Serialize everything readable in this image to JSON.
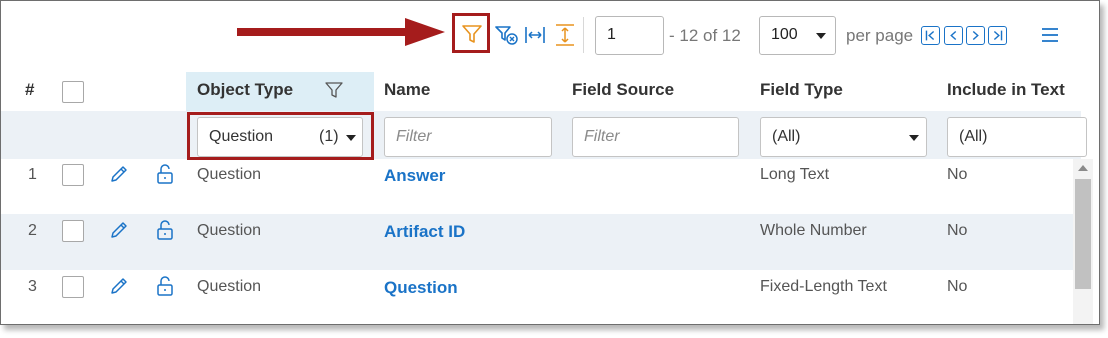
{
  "toolbar": {
    "filter_icon": "filter-icon",
    "clear_filter_icon": "clear-filters-icon",
    "fit_columns_icon": "fit-columns-icon",
    "expand_rows_icon": "expand-rows-icon",
    "menu_icon": "hamburger-menu-icon",
    "accent_color": "#1a73c7",
    "highlight_color": "#e8931e",
    "annotation_color": "#a51c1c"
  },
  "pager": {
    "page": "1",
    "count": "- 12 of 12",
    "per_page_value": "100",
    "per_page_label": "per page"
  },
  "table": {
    "headers": {
      "index": "#",
      "object_type": "Object Type",
      "name": "Name",
      "field_source": "Field Source",
      "field_type": "Field Type",
      "include_in_text": "Include in Text"
    },
    "filters": {
      "object_type_value": "Question",
      "object_type_count": "(1)",
      "name_placeholder": "Filter",
      "field_source_placeholder": "Filter",
      "field_type_value": "(All)",
      "include_value": "(All)"
    },
    "rows": [
      {
        "num": "1",
        "object_type": "Question",
        "name": "Answer",
        "field_source": "",
        "field_type": "Long Text",
        "include": "No"
      },
      {
        "num": "2",
        "object_type": "Question",
        "name": "Artifact ID",
        "field_source": "",
        "field_type": "Whole Number",
        "include": "No"
      },
      {
        "num": "3",
        "object_type": "Question",
        "name": "Question",
        "field_source": "",
        "field_type": "Fixed-Length Text",
        "include": "No"
      }
    ]
  }
}
